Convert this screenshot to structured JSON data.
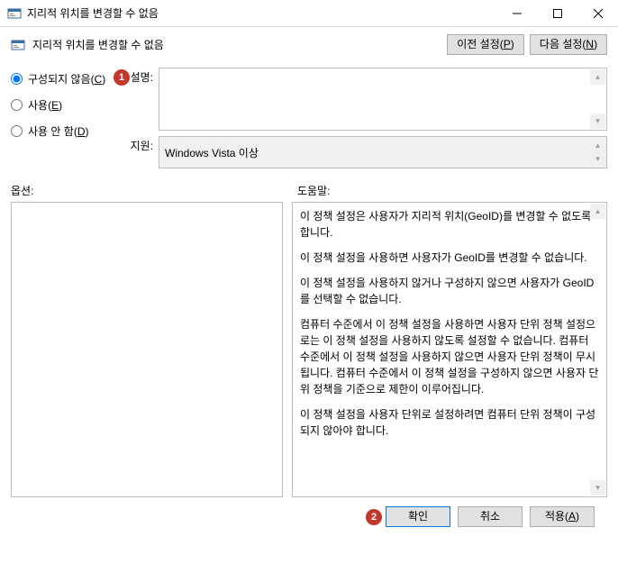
{
  "window": {
    "title": "지리적 위치를 변경할 수 없음"
  },
  "header": {
    "title": "지리적 위치를 변경할 수 없음",
    "prev_label": "이전 설정",
    "prev_accel": "P",
    "next_label": "다음 설정",
    "next_accel": "N"
  },
  "radios": {
    "not_configured": "구성되지 않음",
    "not_configured_accel": "C",
    "enabled": "사용",
    "enabled_accel": "E",
    "disabled": "사용 안 함",
    "disabled_accel": "D",
    "selected": "not_configured"
  },
  "fields": {
    "comment_label": "설명:",
    "comment_value": "",
    "supported_label": "지원:",
    "supported_value": "Windows Vista 이상"
  },
  "sections": {
    "options_label": "옵션:",
    "help_label": "도움말:"
  },
  "help": {
    "p1": "이 정책 설정은 사용자가 지리적 위치(GeoID)를 변경할 수 없도록 합니다.",
    "p2": "이 정책 설정을 사용하면 사용자가 GeoID를 변경할 수 없습니다.",
    "p3": "이 정책 설정을 사용하지 않거나 구성하지 않으면 사용자가 GeoID를 선택할 수 없습니다.",
    "p4": "컴퓨터 수준에서 이 정책 설정을 사용하면 사용자 단위 정책 설정으로는 이 정책 설정을 사용하지 않도록 설정할 수 없습니다. 컴퓨터 수준에서 이 정책 설정을 사용하지 않으면 사용자 단위 정책이 무시됩니다. 컴퓨터 수준에서 이 정책 설정을 구성하지 않으면 사용자 단위 정책을 기준으로 제한이 이루어집니다.",
    "p5": "이 정책 설정을 사용자 단위로 설정하려면 컴퓨터 단위 정책이 구성되지 않아야 합니다."
  },
  "footer": {
    "ok": "확인",
    "cancel": "취소",
    "apply": "적용",
    "apply_accel": "A"
  },
  "annotations": {
    "badge1": "1",
    "badge2": "2"
  }
}
